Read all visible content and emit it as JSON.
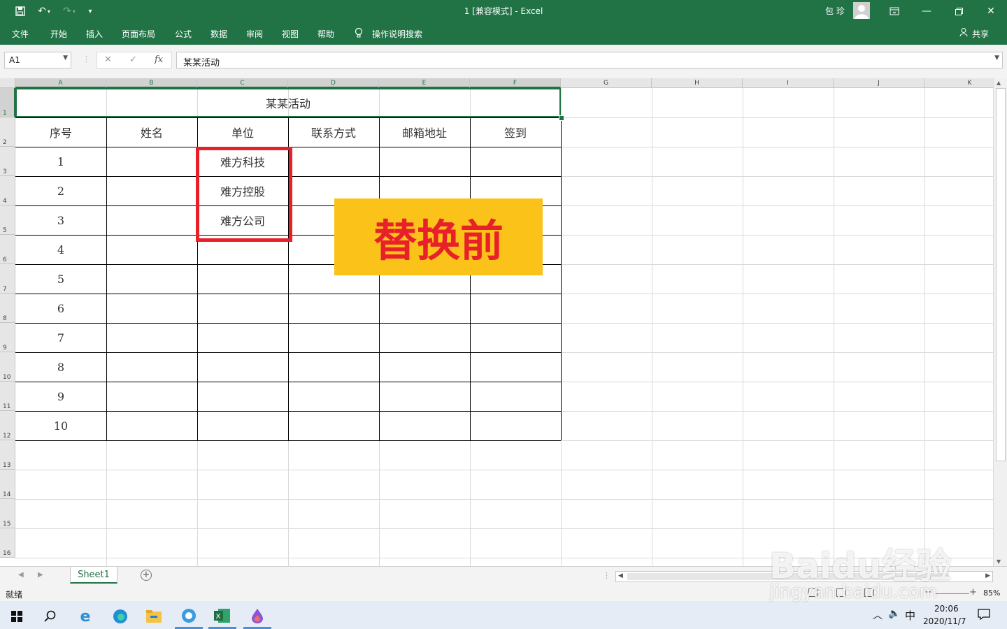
{
  "window": {
    "title": "1  [兼容模式]  -  Excel",
    "user_name": "包 珍",
    "theme_color": "#217346"
  },
  "menu": {
    "items": [
      "文件",
      "开始",
      "插入",
      "页面布局",
      "公式",
      "数据",
      "审阅",
      "视图",
      "帮助"
    ],
    "tell_me": "操作说明搜索",
    "share": "共享"
  },
  "formula_bar": {
    "name_box": "A1",
    "fx_label": "fx",
    "value": "某某活动"
  },
  "sheet": {
    "columns": [
      "A",
      "B",
      "C",
      "D",
      "E",
      "F",
      "G",
      "H",
      "I",
      "J",
      "K"
    ],
    "rows": [
      "1",
      "2",
      "3",
      "4",
      "5",
      "6",
      "7",
      "8",
      "9",
      "10",
      "11",
      "12",
      "13",
      "14",
      "15",
      "16"
    ],
    "title": "某某活动",
    "headers": [
      "序号",
      "姓名",
      "单位",
      "联系方式",
      "邮箱地址",
      "签到"
    ],
    "seq_numbers": [
      "1",
      "2",
      "3",
      "4",
      "5",
      "6",
      "7",
      "8",
      "9",
      "10"
    ],
    "units": [
      "难方科技",
      "难方控股",
      "难方公司"
    ]
  },
  "annotation": {
    "label": "替换前",
    "highlight_color": "#e8202a",
    "label_bg": "#fbc31a"
  },
  "tabs": {
    "sheet1": "Sheet1"
  },
  "status": {
    "ready": "就绪",
    "zoom": "85%"
  },
  "taskbar": {
    "ime": "中",
    "time": "20:06",
    "date": "2020/11/7"
  },
  "watermark": {
    "big": "Baidu经验",
    "small": "jingyan.baidu.com"
  }
}
